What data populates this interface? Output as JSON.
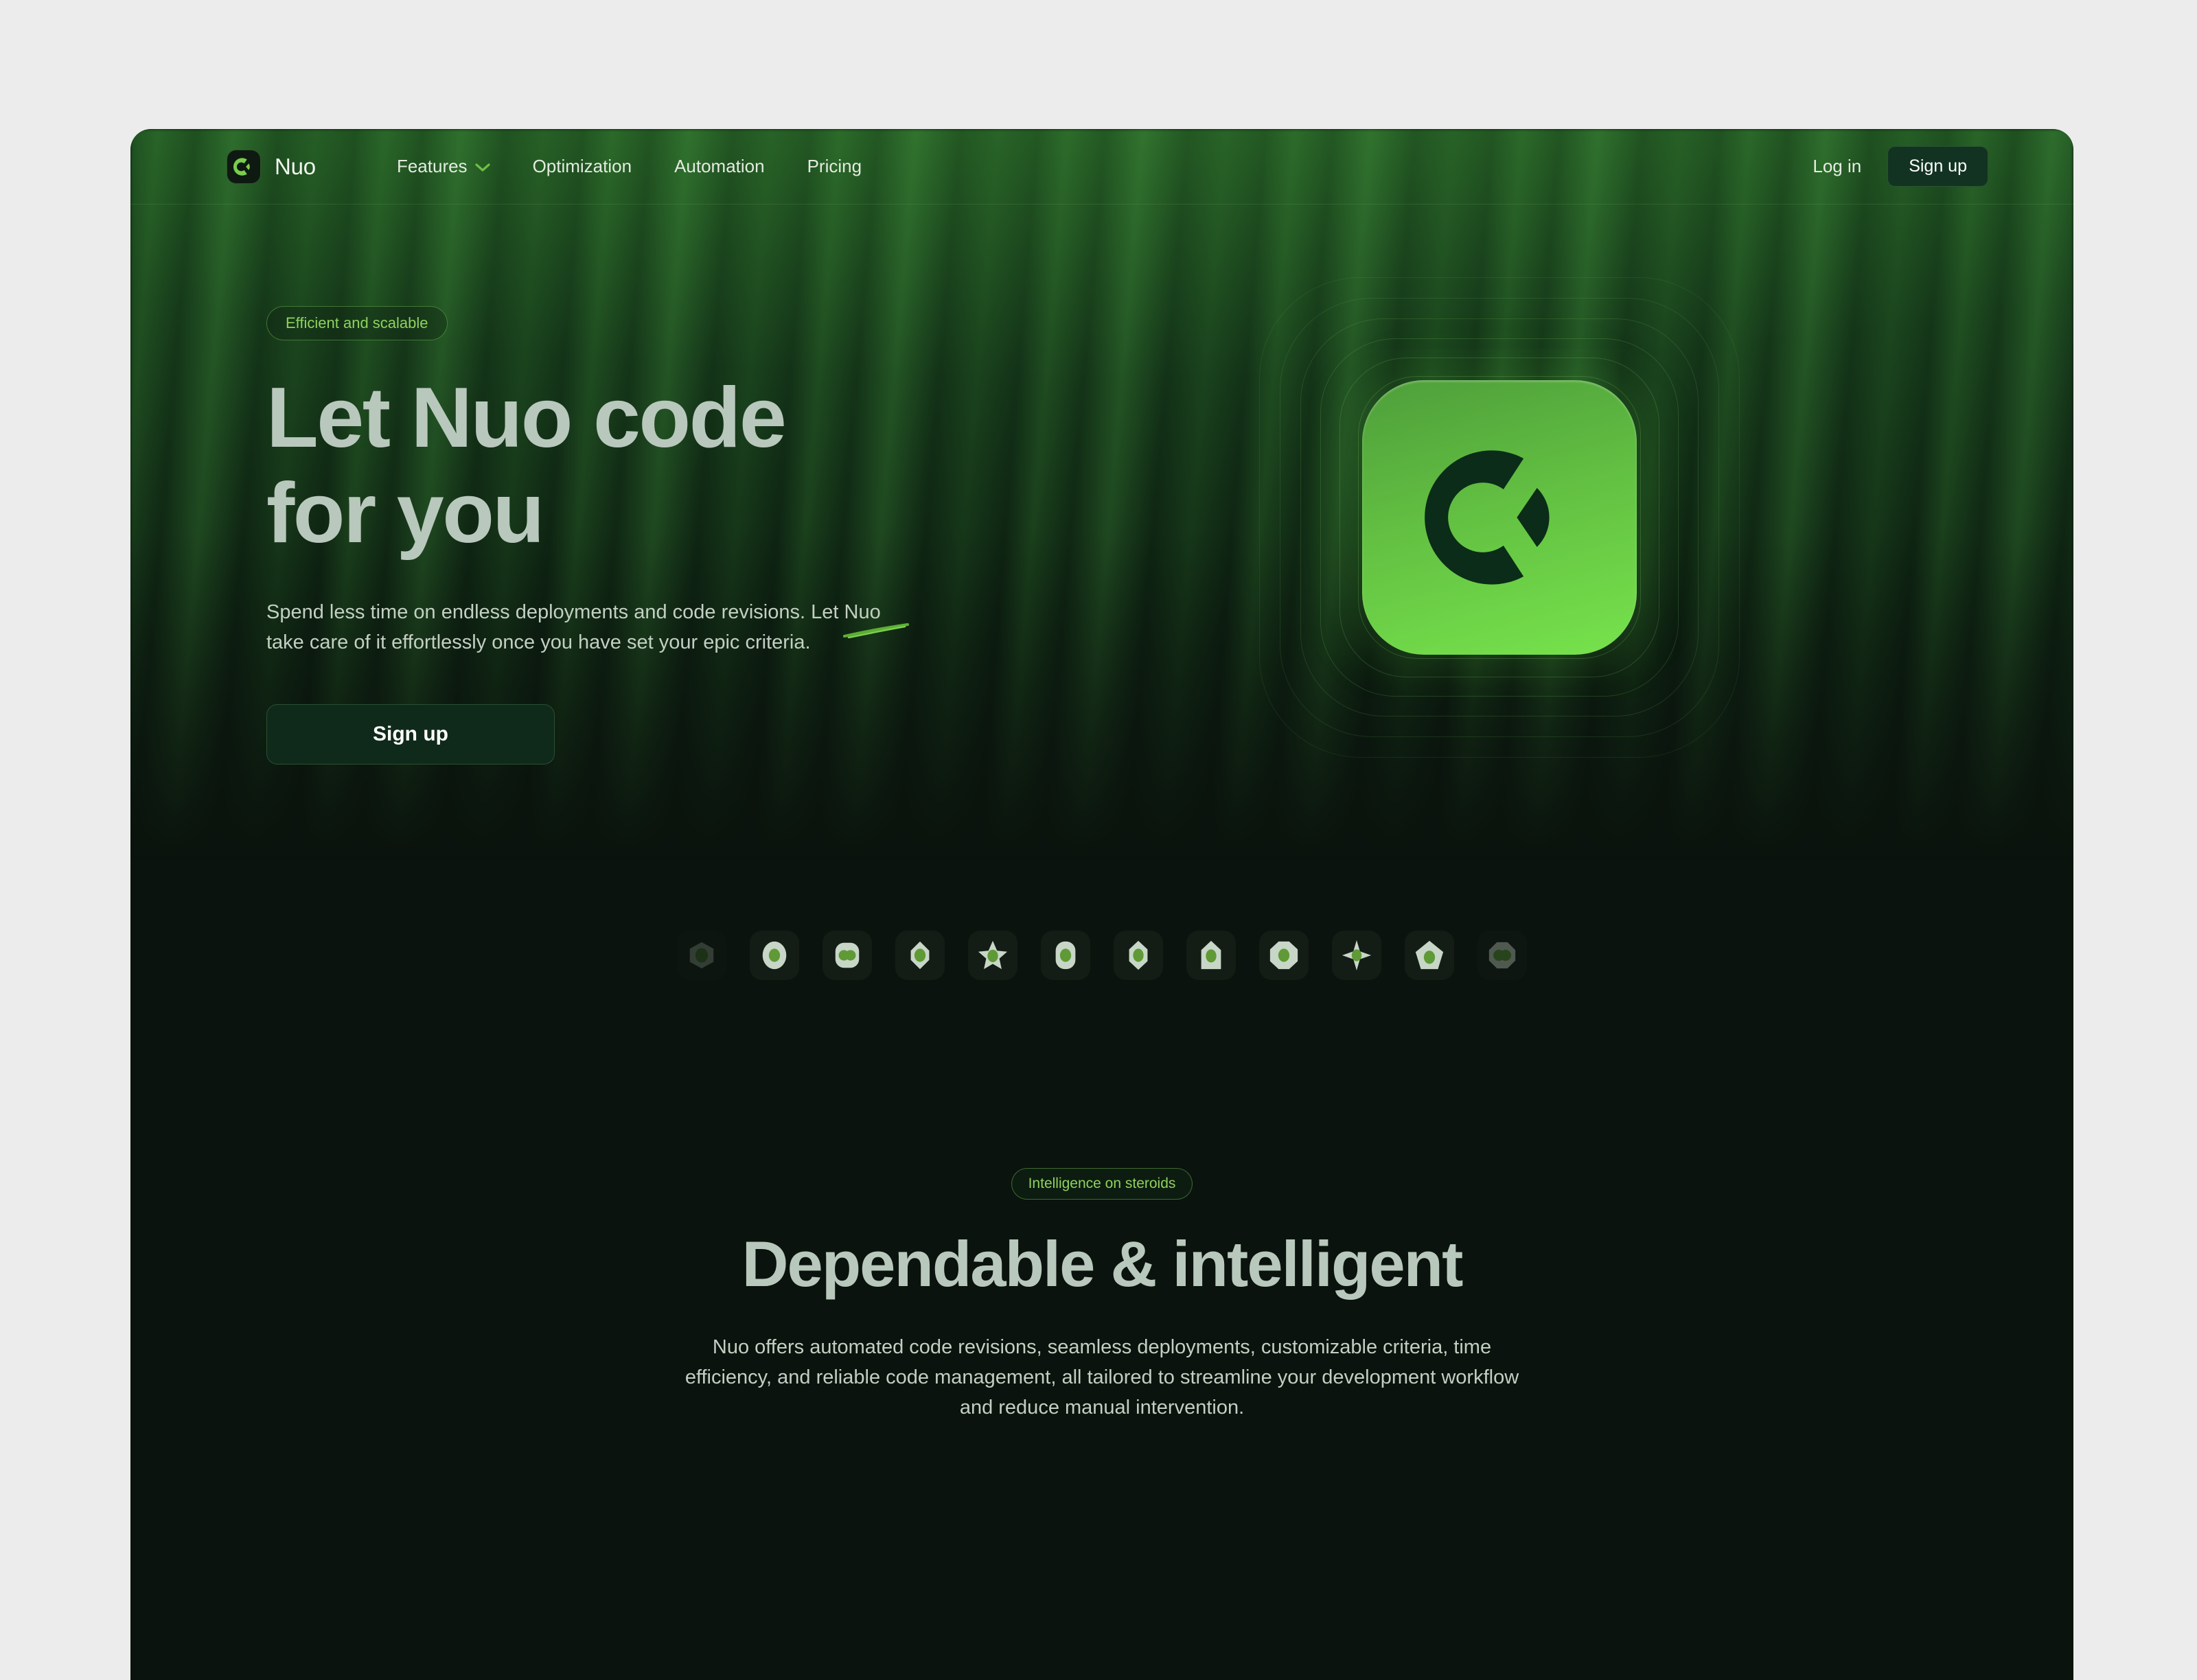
{
  "colors": {
    "page_background": "#ececec",
    "card_background": "#0a130d",
    "accent_green": "#77e34c",
    "accent_green_dark": "#4e9e3a",
    "pill_text": "#8fd25f",
    "heading_text": "#b9c8bc",
    "body_text": "#c3cfc2",
    "nav_text": "#e3ebe0",
    "button_bg": "#123321"
  },
  "navbar": {
    "brand": {
      "name": "Nuo",
      "logo_icon": "nuo-logo-icon"
    },
    "links": [
      {
        "label": "Features",
        "has_dropdown": true,
        "icon": "chevron-down-icon"
      },
      {
        "label": "Optimization",
        "has_dropdown": false
      },
      {
        "label": "Automation",
        "has_dropdown": false
      },
      {
        "label": "Pricing",
        "has_dropdown": false
      }
    ],
    "login_label": "Log in",
    "signup_label": "Sign up"
  },
  "hero": {
    "badge": "Efficient and scalable",
    "title_line1": "Let Nuo code",
    "title_line2": "for you",
    "subtitle_part1": "Spend less time on endless deployments and code revisions. Let ",
    "subtitle_highlight": "Nuo",
    "subtitle_part2": " take care of it effortlessly once you have set your epic criteria.",
    "cta_label": "Sign up",
    "art_icon": "nuo-app-icon"
  },
  "logo_strip": {
    "items": [
      {
        "icon": "hexagon-logo-icon"
      },
      {
        "icon": "ellipse-logo-icon"
      },
      {
        "icon": "rounded-square-logo-icon"
      },
      {
        "icon": "leaf-logo-icon"
      },
      {
        "icon": "star-logo-icon"
      },
      {
        "icon": "capsule-logo-icon"
      },
      {
        "icon": "diamond-logo-icon"
      },
      {
        "icon": "shield-logo-icon"
      },
      {
        "icon": "octagon-logo-icon"
      },
      {
        "icon": "star-alt-logo-icon"
      },
      {
        "icon": "pentagon-logo-icon"
      },
      {
        "icon": "bean-logo-icon"
      }
    ]
  },
  "section2": {
    "badge": "Intelligence on steroids",
    "title": "Dependable & intelligent",
    "body": "Nuo offers automated code revisions, seamless deployments, customizable criteria, time efficiency, and reliable code management, all tailored to streamline your development workflow and reduce manual intervention."
  }
}
